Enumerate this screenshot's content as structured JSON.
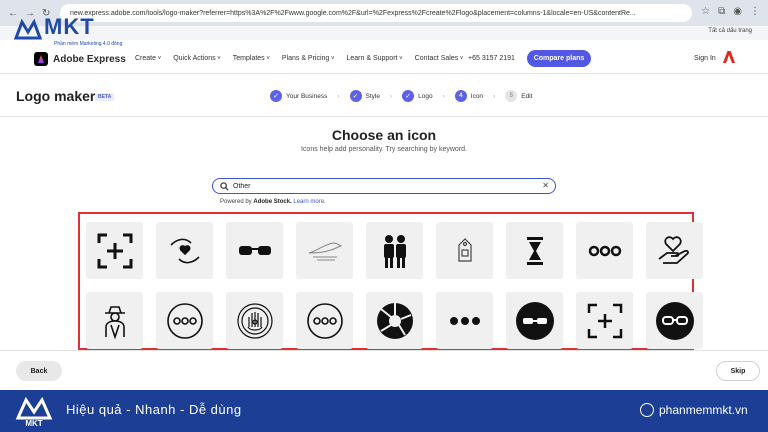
{
  "browser": {
    "url": "new.express.adobe.com/tools/logo-maker?referrer=https%3A%2F%2Fwww.google.com%2F&url=%2Fexpress%2Fcreate%2Flogo&placement=columns-1&locale=en-US&contentRe...",
    "bookmark": "Tất cả dấu trang"
  },
  "watermark": {
    "brand": "MKT",
    "tagline": "Phần mềm Marketing 4.0 đồng"
  },
  "nav": {
    "brand": "Adobe Express",
    "menu": [
      "Create",
      "Quick Actions",
      "Templates",
      "Plans & Pricing",
      "Learn & Support",
      "Contact Sales"
    ],
    "phone": "+65 3157 2191",
    "compare": "Compare plans",
    "signin": "Sign In"
  },
  "page": {
    "title": "Logo maker",
    "badge": "BETA",
    "steps": [
      {
        "label": "Your Business",
        "state": "done"
      },
      {
        "label": "Style",
        "state": "done"
      },
      {
        "label": "Logo",
        "state": "done"
      },
      {
        "label": "Icon",
        "state": "current",
        "number": "4"
      },
      {
        "label": "Edit",
        "state": "todo",
        "number": "5"
      }
    ]
  },
  "content": {
    "heading": "Choose an icon",
    "subheading": "Icons help add personality. Try searching by keyword.",
    "search_value": "Other",
    "powered_prefix": "Powered by ",
    "powered_brand": "Adobe Stock.",
    "learn_more": "Learn more."
  },
  "icons": [
    "add-frame-icon",
    "hands-heart-icon",
    "sunglasses-icon",
    "bird-sketch-icon",
    "two-people-icon",
    "price-tag-icon",
    "hourglass-icon",
    "three-dots-icon",
    "hand-heart-icon",
    "spy-person-icon",
    "three-dots-circle-icon",
    "hamsa-eye-icon",
    "three-dots-circle-icon",
    "camera-shutter-icon",
    "three-dots-bold-icon",
    "sunglasses-circle-icon",
    "add-frame-icon",
    "glasses-circle-icon"
  ],
  "footer_actions": {
    "back": "Back",
    "skip": "Skip"
  },
  "banner": {
    "tagline": "Hiệu quả  -  Nhanh   -  Dễ dùng",
    "site": "phanmemmkt.vn",
    "brand": "MKT"
  },
  "colors": {
    "accent": "#5258e4",
    "highlight": "#e03030",
    "banner": "#1c3f95"
  }
}
